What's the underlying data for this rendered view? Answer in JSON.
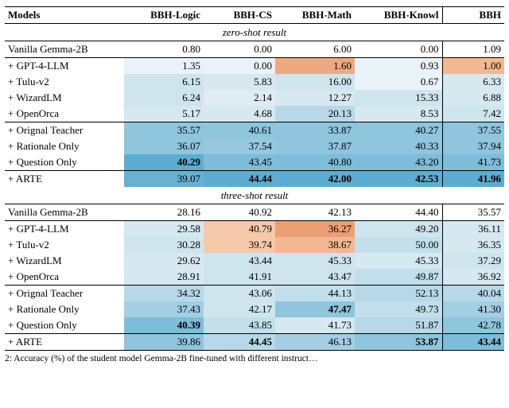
{
  "chart_data": {
    "type": "table",
    "title": "Accuracy (%) of the student model Gemma-2B fine-tuned with different instruct…",
    "columns": [
      "Models",
      "BBH-Logic",
      "BBH-CS",
      "BBH-Math",
      "BBH-Knowl",
      "BBH"
    ],
    "sections": [
      {
        "heading": "zero-shot result",
        "groups": [
          {
            "rows": [
              {
                "model": "Vanilla Gemma-2B",
                "vals": [
                  "0.80",
                  "0.00",
                  "6.00",
                  "0.00",
                  "1.09"
                ]
              }
            ]
          },
          {
            "rows": [
              {
                "model": "+ GPT-4-LLM",
                "vals": [
                  "1.35",
                  "0.00",
                  "1.60",
                  "0.93",
                  "1.00"
                ]
              },
              {
                "model": "+ Tulu-v2",
                "vals": [
                  "6.15",
                  "5.83",
                  "16.00",
                  "0.67",
                  "6.33"
                ]
              },
              {
                "model": "+ WizardLM",
                "vals": [
                  "6.24",
                  "2.14",
                  "12.27",
                  "15.33",
                  "6.88"
                ]
              },
              {
                "model": "+ OpenOrca",
                "vals": [
                  "5.17",
                  "4.68",
                  "20.13",
                  "8.53",
                  "7.42"
                ]
              }
            ]
          },
          {
            "rows": [
              {
                "model": "+ Orignal Teacher",
                "vals": [
                  "35.57",
                  "40.61",
                  "33.87",
                  "40.27",
                  "37.55"
                ]
              },
              {
                "model": "+ Rationale Only",
                "vals": [
                  "36.07",
                  "37.54",
                  "37.87",
                  "40.33",
                  "37.94"
                ]
              },
              {
                "model": "+ Question Only",
                "vals": [
                  "40.29",
                  "43.45",
                  "40.80",
                  "43.20",
                  "41.73"
                ],
                "bold": [
                  0
                ]
              }
            ]
          },
          {
            "rows": [
              {
                "model": "+ ARTE",
                "vals": [
                  "39.07",
                  "44.44",
                  "42.00",
                  "42.53",
                  "41.96"
                ],
                "bold": [
                  1,
                  2,
                  3,
                  4
                ]
              }
            ]
          }
        ]
      },
      {
        "heading": "three-shot result",
        "groups": [
          {
            "rows": [
              {
                "model": "Vanilla Gemma-2B",
                "vals": [
                  "28.16",
                  "40.92",
                  "42.13",
                  "44.40",
                  "35.57"
                ]
              }
            ]
          },
          {
            "rows": [
              {
                "model": "+ GPT-4-LLM",
                "vals": [
                  "29.58",
                  "40.79",
                  "36.27",
                  "49.20",
                  "36.11"
                ]
              },
              {
                "model": "+ Tulu-v2",
                "vals": [
                  "30.28",
                  "39.74",
                  "38.67",
                  "50.00",
                  "36.35"
                ]
              },
              {
                "model": "+ WizardLM",
                "vals": [
                  "29.62",
                  "43.44",
                  "45.33",
                  "45.33",
                  "37.29"
                ]
              },
              {
                "model": "+ OpenOrca",
                "vals": [
                  "28.91",
                  "41.91",
                  "43.47",
                  "49.87",
                  "36.92"
                ]
              }
            ]
          },
          {
            "rows": [
              {
                "model": "+ Orignal Teacher",
                "vals": [
                  "34.32",
                  "43.06",
                  "44.13",
                  "52.13",
                  "40.04"
                ]
              },
              {
                "model": "+ Rationale Only",
                "vals": [
                  "37.43",
                  "42.17",
                  "47.47",
                  "49.73",
                  "41.30"
                ],
                "bold": [
                  2
                ]
              },
              {
                "model": "+ Question Only",
                "vals": [
                  "40.39",
                  "43.85",
                  "41.73",
                  "51.87",
                  "42.78"
                ],
                "bold": [
                  0
                ]
              }
            ]
          },
          {
            "rows": [
              {
                "model": "+ ARTE",
                "vals": [
                  "39.86",
                  "44.45",
                  "46.13",
                  "53.87",
                  "43.44"
                ],
                "bold": [
                  1,
                  3,
                  4
                ]
              }
            ]
          }
        ]
      }
    ],
    "heatmap": {
      "palette_note": "cell backgrounds vary: light-blue for high values, pale/orange-peach for low/decrease",
      "zero_shot": [
        [
          null,
          null,
          null,
          null,
          null
        ],
        [
          "#e9f2f8",
          "#e9f2f8",
          "#eea981",
          "#e9f2f8",
          "#f3b891"
        ],
        [
          "#cfe5ee",
          "#d6e8f0",
          "#cfe5ee",
          "#eaf3f8",
          "#d6e8f0"
        ],
        [
          "#cfe5ee",
          "#dfecf3",
          "#d6e8f0",
          "#cfe5ee",
          "#d6e8f0"
        ],
        [
          "#d6e8f0",
          "#d6e8f0",
          "#b7d8e8",
          "#d6e8f0",
          "#cfe5ee"
        ],
        [
          "#8fc5dd",
          "#8fc5dd",
          "#8fc5dd",
          "#8fc5dd",
          "#8fc5dd"
        ],
        [
          "#8fc5dd",
          "#96c9df",
          "#8fc5dd",
          "#8fc5dd",
          "#8fc5dd"
        ],
        [
          "#5cadd1",
          "#7dbdd9",
          "#7dbdd9",
          "#7dbdd9",
          "#7dbdd9"
        ],
        [
          "#67b2d3",
          "#5cadd1",
          "#5cadd1",
          "#5cadd1",
          "#5cadd1"
        ]
      ],
      "three_shot": [
        [
          null,
          null,
          null,
          null,
          null
        ],
        [
          "#d6e8f0",
          "#f6c9ab",
          "#eb9f74",
          "#cfe5ee",
          "#d6e8f0"
        ],
        [
          "#cfe5ee",
          "#f6c9ab",
          "#f3b891",
          "#c3dfec",
          "#d6e8f0"
        ],
        [
          "#d6e8f0",
          "#cfe5ee",
          "#cfe5ee",
          "#d6e8f0",
          "#cfe5ee"
        ],
        [
          "#d6e8f0",
          "#cfe5ee",
          "#cfe5ee",
          "#c3dfec",
          "#d6e8f0"
        ],
        [
          "#b7d8e8",
          "#cfe5ee",
          "#c3dfec",
          "#b7d8e8",
          "#b7d8e8"
        ],
        [
          "#a3cee3",
          "#cfe5ee",
          "#8fc5dd",
          "#c3dfec",
          "#a3cee3"
        ],
        [
          "#7dbdd9",
          "#c3dfec",
          "#d6e8f0",
          "#b7d8e8",
          "#8fc5dd"
        ],
        [
          "#8fc5dd",
          "#b7d8e8",
          "#a3cee3",
          "#8fc5dd",
          "#7dbdd9"
        ]
      ]
    }
  },
  "caption_prefix": "2:",
  "caption_text": "Accuracy (%) of the student model Gemma-2B fine-tuned with different instruct…"
}
